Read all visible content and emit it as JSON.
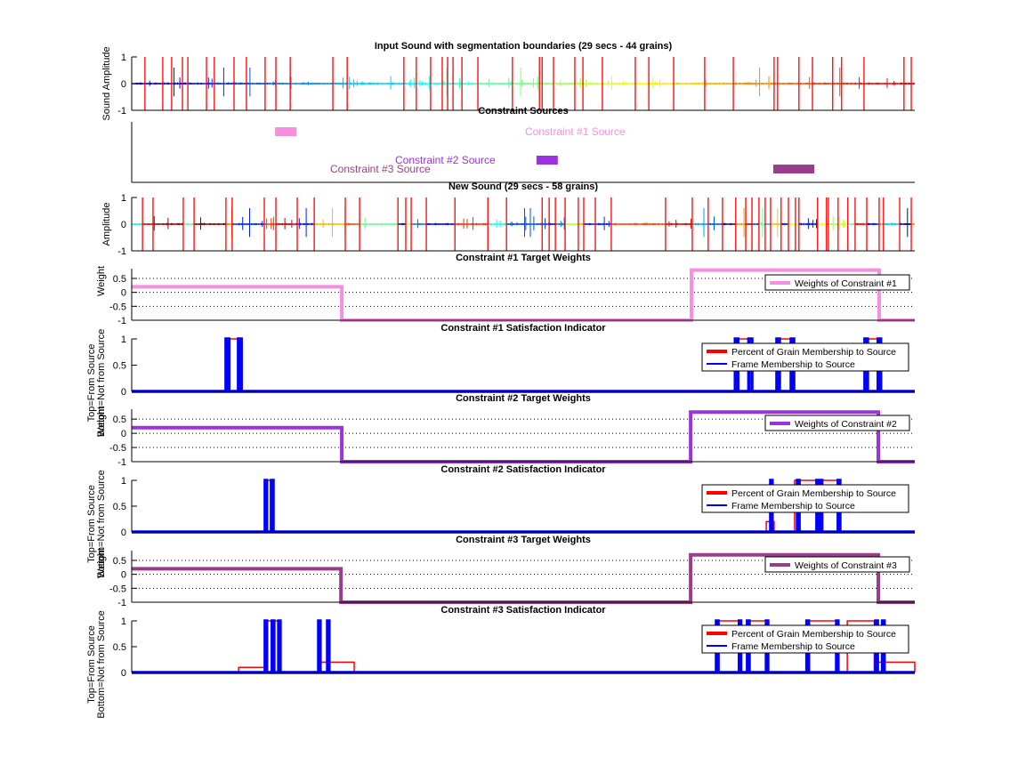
{
  "chart_data": [
    {
      "type": "line",
      "title": "Input Sound with segmentation boundaries (29 secs - 44 grains)",
      "ylabel": "Sound Amplitude",
      "xlim": [
        0,
        29
      ],
      "ylim": [
        -1,
        1
      ],
      "yticks": [
        1,
        0,
        -1
      ],
      "boundary_color": "#ff0000",
      "waveform_colormap": "jet",
      "boundaries": [
        0.49,
        1.15,
        1.48,
        1.88,
        2.08,
        2.77,
        3.06,
        3.79,
        4.25,
        4.94,
        5.34,
        5.87,
        7.45,
        7.98,
        10.08,
        10.54,
        11.07,
        11.5,
        11.7,
        11.9,
        12.23,
        12.82,
        14.1,
        15.1,
        15.2,
        15.62,
        16.41,
        16.71,
        17.43,
        18.65,
        19.15,
        20.07,
        21.22,
        22.28,
        23.79,
        23.92,
        24.71,
        25.21,
        25.96,
        26.29,
        27.12,
        28.6,
        28.87
      ]
    },
    {
      "type": "bar",
      "title": "Constraint Sources",
      "xlim": [
        0,
        29
      ],
      "ylim": [
        0,
        4
      ],
      "sources": [
        {
          "label": "Constraint #1 Source",
          "start": 5.31,
          "end": 6.1,
          "level": 3.35,
          "color": "#f78fe0"
        },
        {
          "label": "Constraint #2 Source",
          "start": 14.99,
          "end": 15.78,
          "level": 1.47,
          "color": "#9933dd"
        },
        {
          "label": "Constraint #3 Source",
          "start": 23.76,
          "end": 25.28,
          "level": 0.88,
          "color": "#993d8a"
        }
      ]
    },
    {
      "type": "line",
      "title": "New Sound (29 secs - 58 grains)",
      "ylabel": "Amplitude",
      "xlim": [
        0,
        29
      ],
      "ylim": [
        -1,
        1
      ],
      "yticks": [
        1,
        0,
        -1
      ],
      "boundary_color": "#ff0000",
      "boundaries": [
        0.4,
        0.79,
        1.91,
        2.31,
        3.49,
        3.72,
        4.91,
        5.34,
        6.13,
        6.76,
        7.91,
        8.44,
        9.86,
        10.15,
        10.35,
        10.91,
        11.97,
        13.19,
        13.88,
        15.2,
        15.46,
        15.69,
        16.05,
        16.54,
        16.74,
        17.17,
        17.76,
        19.77,
        20.76,
        21.35,
        21.88,
        22.37,
        22.74,
        22.97,
        23.23,
        23.46,
        23.66,
        24.05,
        24.32,
        24.58,
        24.71,
        25.4,
        25.73,
        25.8,
        26.16,
        26.52,
        26.79,
        27.22,
        27.68,
        27.84,
        28.44,
        28.87
      ]
    },
    {
      "type": "line",
      "title": "Constraint #1 Target Weights",
      "ylabel": "Weight",
      "xlim": [
        0,
        29
      ],
      "ylim": [
        -1,
        0.85
      ],
      "yticks": [
        0.5,
        0,
        -0.5,
        -1
      ],
      "grid": true,
      "legend": "top-right",
      "series": [
        {
          "name": "Weights of Constraint #1",
          "color": "#f78fe0",
          "steps": [
            [
              0,
              7.78,
              0.2
            ],
            [
              7.78,
              20.73,
              -1
            ],
            [
              20.73,
              27.68,
              0.8
            ],
            [
              27.68,
              29,
              -1
            ]
          ]
        }
      ]
    },
    {
      "type": "line",
      "title": "Constraint #1 Satisfaction Indicator",
      "ylabel": [
        "Top=From Source",
        "Bottom=Not from Source"
      ],
      "xlim": [
        0,
        29
      ],
      "ylim": [
        0,
        1
      ],
      "yticks": [
        1,
        0.5,
        0
      ],
      "legend": "top-right",
      "series": [
        {
          "name": "Percent of Grain Membership to Source",
          "color": "#ff0000",
          "steps": [
            [
              3.49,
              4.06,
              1
            ],
            [
              22.35,
              22.97,
              1
            ],
            [
              23.89,
              24.52,
              1
            ],
            [
              27.15,
              27.74,
              1
            ]
          ]
        },
        {
          "name": "Frame Membership to Source",
          "color": "#0000ff",
          "steps": [
            [
              3.49,
              3.6,
              1
            ],
            [
              3.95,
              4.06,
              1
            ],
            [
              22.35,
              22.45,
              1
            ],
            [
              22.85,
              22.97,
              1
            ],
            [
              23.89,
              23.99,
              1
            ],
            [
              24.42,
              24.52,
              1
            ],
            [
              27.15,
              27.25,
              1
            ],
            [
              27.64,
              27.74,
              1
            ]
          ]
        }
      ]
    },
    {
      "type": "line",
      "title": "Constraint #2 Target Weights",
      "ylabel": "Weight",
      "xlim": [
        0,
        29
      ],
      "ylim": [
        -1,
        0.85
      ],
      "yticks": [
        0.5,
        0,
        -0.5,
        -1
      ],
      "grid": true,
      "legend": "top-right",
      "series": [
        {
          "name": "Weights of Constraint #2",
          "color": "#9933dd",
          "steps": [
            [
              0,
              7.78,
              0.2
            ],
            [
              7.78,
              20.7,
              -1
            ],
            [
              20.7,
              27.65,
              0.75
            ],
            [
              27.65,
              29,
              -1
            ]
          ]
        }
      ]
    },
    {
      "type": "line",
      "title": "Constraint #2 Satisfaction Indicator",
      "ylabel": [
        "Top=From Source",
        "Bottom=Not from Source"
      ],
      "xlim": [
        0,
        29
      ],
      "ylim": [
        0,
        1
      ],
      "yticks": [
        1,
        0.5,
        0
      ],
      "legend": "top-right",
      "series": [
        {
          "name": "Percent of Grain Membership to Source",
          "color": "#ff0000",
          "steps": [
            [
              4.94,
              5.24,
              1
            ],
            [
              23.5,
              23.79,
              0.2
            ],
            [
              24.55,
              26.23,
              1
            ]
          ]
        },
        {
          "name": "Frame Membership to Source",
          "color": "#0000ff",
          "steps": [
            [
              4.94,
              5.0,
              1
            ],
            [
              5.17,
              5.24,
              1
            ],
            [
              23.66,
              23.72,
              1
            ],
            [
              24.65,
              24.72,
              1
            ],
            [
              25.37,
              25.43,
              1
            ],
            [
              25.5,
              25.56,
              1
            ],
            [
              26.16,
              26.23,
              1
            ]
          ]
        }
      ]
    },
    {
      "type": "line",
      "title": "Constraint #3 Target Weights",
      "ylabel": "Weight",
      "xlim": [
        0,
        29
      ],
      "ylim": [
        -1,
        0.85
      ],
      "yticks": [
        0.5,
        0,
        -0.5,
        -1
      ],
      "grid": true,
      "legend": "top-right",
      "series": [
        {
          "name": "Weights of Constraint #3",
          "color": "#993d8a",
          "steps": [
            [
              0,
              7.75,
              0.2
            ],
            [
              7.75,
              20.7,
              -1
            ],
            [
              20.7,
              27.65,
              0.7
            ],
            [
              27.65,
              29,
              -1
            ]
          ]
        }
      ]
    },
    {
      "type": "line",
      "title": "Constraint #3 Satisfaction Indicator",
      "ylabel": [
        "Top=From Source",
        "Bottom=Not from Source"
      ],
      "xlim": [
        0,
        29
      ],
      "ylim": [
        0,
        1
      ],
      "yticks": [
        1,
        0.5,
        0
      ],
      "legend": "top-right",
      "series": [
        {
          "name": "Percent of Grain Membership to Source",
          "color": "#ff0000",
          "steps": [
            [
              3.96,
              4.94,
              0.1
            ],
            [
              4.94,
              5.5,
              1
            ],
            [
              6.92,
              8.24,
              0.2
            ],
            [
              21.65,
              22.5,
              1
            ],
            [
              22.8,
              23.5,
              1
            ],
            [
              25.0,
              26.16,
              1
            ],
            [
              26.5,
              27.5,
              1
            ],
            [
              27.55,
              29,
              0.2
            ]
          ]
        },
        {
          "name": "Frame Membership to Source",
          "color": "#0000ff",
          "steps": [
            [
              4.94,
              5.0,
              1
            ],
            [
              5.2,
              5.27,
              1
            ],
            [
              5.44,
              5.5,
              1
            ],
            [
              6.92,
              6.98,
              1
            ],
            [
              7.25,
              7.31,
              1
            ],
            [
              21.65,
              21.72,
              1
            ],
            [
              22.5,
              22.56,
              1
            ],
            [
              22.8,
              22.87,
              1
            ],
            [
              23.5,
              23.56,
              1
            ],
            [
              25.0,
              25.07,
              1
            ],
            [
              26.1,
              26.16,
              1
            ],
            [
              27.55,
              27.62,
              1
            ],
            [
              27.8,
              27.87,
              1
            ]
          ]
        }
      ]
    }
  ]
}
